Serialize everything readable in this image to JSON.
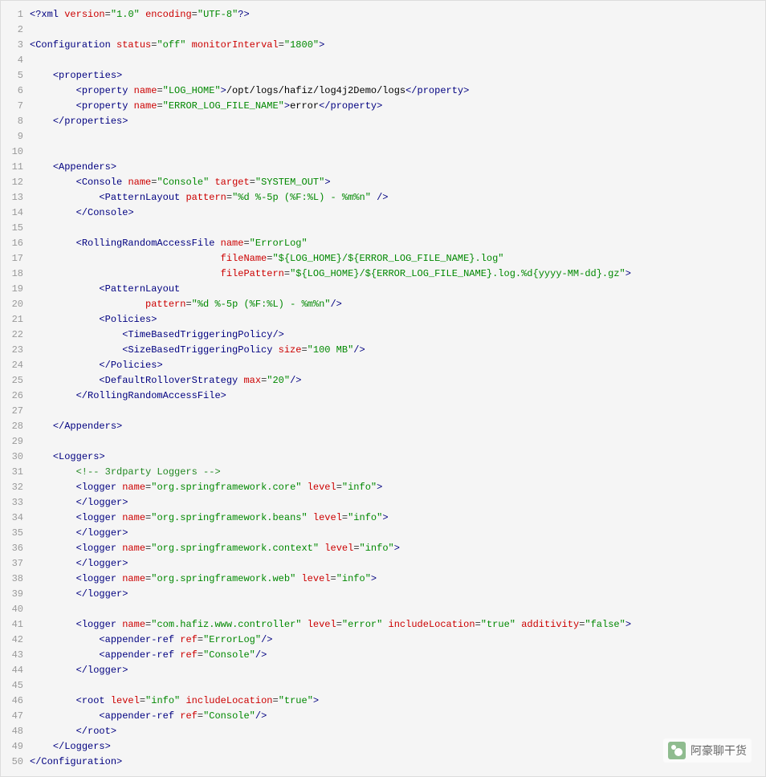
{
  "watermark": "阿豪聊干货",
  "lines": [
    {
      "n": 1,
      "h": "<span class='pi'>&lt;?</span><span class='tag'>xml</span> <span class='attr'>version</span>=<span class='val'>\"1.0\"</span> <span class='attr'>encoding</span>=<span class='val'>\"UTF-8\"</span><span class='pi'>?&gt;</span>"
    },
    {
      "n": 2,
      "h": ""
    },
    {
      "n": 3,
      "h": "<span class='punc'>&lt;</span><span class='tag'>Configuration</span> <span class='attr'>status</span>=<span class='val'>\"off\"</span> <span class='attr'>monitorInterval</span>=<span class='val'>\"1800\"</span><span class='punc'>&gt;</span>"
    },
    {
      "n": 4,
      "h": ""
    },
    {
      "n": 5,
      "h": "    <span class='punc'>&lt;</span><span class='tag'>properties</span><span class='punc'>&gt;</span>"
    },
    {
      "n": 6,
      "h": "        <span class='punc'>&lt;</span><span class='tag'>property</span> <span class='attr'>name</span>=<span class='val'>\"LOG_HOME\"</span><span class='punc'>&gt;</span><span class='txt'>/opt/logs/hafiz/log4j2Demo/logs</span><span class='punc'>&lt;/</span><span class='tag'>property</span><span class='punc'>&gt;</span>"
    },
    {
      "n": 7,
      "h": "        <span class='punc'>&lt;</span><span class='tag'>property</span> <span class='attr'>name</span>=<span class='val'>\"ERROR_LOG_FILE_NAME\"</span><span class='punc'>&gt;</span><span class='txt'>error</span><span class='punc'>&lt;/</span><span class='tag'>property</span><span class='punc'>&gt;</span>"
    },
    {
      "n": 8,
      "h": "    <span class='punc'>&lt;/</span><span class='tag'>properties</span><span class='punc'>&gt;</span>"
    },
    {
      "n": 9,
      "h": ""
    },
    {
      "n": 10,
      "h": ""
    },
    {
      "n": 11,
      "h": "    <span class='punc'>&lt;</span><span class='tag'>Appenders</span><span class='punc'>&gt;</span>"
    },
    {
      "n": 12,
      "h": "        <span class='punc'>&lt;</span><span class='tag'>Console</span> <span class='attr'>name</span>=<span class='val'>\"Console\"</span> <span class='attr'>target</span>=<span class='val'>\"SYSTEM_OUT\"</span><span class='punc'>&gt;</span>"
    },
    {
      "n": 13,
      "h": "            <span class='punc'>&lt;</span><span class='tag'>PatternLayout</span> <span class='attr'>pattern</span>=<span class='val'>\"%d %-5p (%F:%L) - %m%n\"</span> <span class='punc'>/&gt;</span>"
    },
    {
      "n": 14,
      "h": "        <span class='punc'>&lt;/</span><span class='tag'>Console</span><span class='punc'>&gt;</span>"
    },
    {
      "n": 15,
      "h": ""
    },
    {
      "n": 16,
      "h": "        <span class='punc'>&lt;</span><span class='tag'>RollingRandomAccessFile</span> <span class='attr'>name</span>=<span class='val'>\"ErrorLog\"</span>"
    },
    {
      "n": 17,
      "h": "                                 <span class='attr'>fileName</span>=<span class='val'>\"${LOG_HOME}/${ERROR_LOG_FILE_NAME}.log\"</span>"
    },
    {
      "n": 18,
      "h": "                                 <span class='attr'>filePattern</span>=<span class='val'>\"${LOG_HOME}/${ERROR_LOG_FILE_NAME}.log.%d{yyyy-MM-dd}.gz\"</span><span class='punc'>&gt;</span>"
    },
    {
      "n": 19,
      "h": "            <span class='punc'>&lt;</span><span class='tag'>PatternLayout</span>"
    },
    {
      "n": 20,
      "h": "                    <span class='attr'>pattern</span>=<span class='val'>\"%d %-5p (%F:%L) - %m%n\"</span><span class='punc'>/&gt;</span>"
    },
    {
      "n": 21,
      "h": "            <span class='punc'>&lt;</span><span class='tag'>Policies</span><span class='punc'>&gt;</span>"
    },
    {
      "n": 22,
      "h": "                <span class='punc'>&lt;</span><span class='tag'>TimeBasedTriggeringPolicy</span><span class='punc'>/&gt;</span>"
    },
    {
      "n": 23,
      "h": "                <span class='punc'>&lt;</span><span class='tag'>SizeBasedTriggeringPolicy</span> <span class='attr'>size</span>=<span class='val'>\"100 MB\"</span><span class='punc'>/&gt;</span>"
    },
    {
      "n": 24,
      "h": "            <span class='punc'>&lt;/</span><span class='tag'>Policies</span><span class='punc'>&gt;</span>"
    },
    {
      "n": 25,
      "h": "            <span class='punc'>&lt;</span><span class='tag'>DefaultRolloverStrategy</span> <span class='attr'>max</span>=<span class='val'>\"20\"</span><span class='punc'>/&gt;</span>"
    },
    {
      "n": 26,
      "h": "        <span class='punc'>&lt;/</span><span class='tag'>RollingRandomAccessFile</span><span class='punc'>&gt;</span>"
    },
    {
      "n": 27,
      "h": ""
    },
    {
      "n": 28,
      "h": "    <span class='punc'>&lt;/</span><span class='tag'>Appenders</span><span class='punc'>&gt;</span>"
    },
    {
      "n": 29,
      "h": ""
    },
    {
      "n": 30,
      "h": "    <span class='punc'>&lt;</span><span class='tag'>Loggers</span><span class='punc'>&gt;</span>"
    },
    {
      "n": 31,
      "h": "        <span class='comment'>&lt;!-- 3rdparty Loggers --&gt;</span>"
    },
    {
      "n": 32,
      "h": "        <span class='punc'>&lt;</span><span class='tag'>logger</span> <span class='attr'>name</span>=<span class='val'>\"org.springframework.core\"</span> <span class='attr'>level</span>=<span class='val'>\"info\"</span><span class='punc'>&gt;</span>"
    },
    {
      "n": 33,
      "h": "        <span class='punc'>&lt;/</span><span class='tag'>logger</span><span class='punc'>&gt;</span>"
    },
    {
      "n": 34,
      "h": "        <span class='punc'>&lt;</span><span class='tag'>logger</span> <span class='attr'>name</span>=<span class='val'>\"org.springframework.beans\"</span> <span class='attr'>level</span>=<span class='val'>\"info\"</span><span class='punc'>&gt;</span>"
    },
    {
      "n": 35,
      "h": "        <span class='punc'>&lt;/</span><span class='tag'>logger</span><span class='punc'>&gt;</span>"
    },
    {
      "n": 36,
      "h": "        <span class='punc'>&lt;</span><span class='tag'>logger</span> <span class='attr'>name</span>=<span class='val'>\"org.springframework.context\"</span> <span class='attr'>level</span>=<span class='val'>\"info\"</span><span class='punc'>&gt;</span>"
    },
    {
      "n": 37,
      "h": "        <span class='punc'>&lt;/</span><span class='tag'>logger</span><span class='punc'>&gt;</span>"
    },
    {
      "n": 38,
      "h": "        <span class='punc'>&lt;</span><span class='tag'>logger</span> <span class='attr'>name</span>=<span class='val'>\"org.springframework.web\"</span> <span class='attr'>level</span>=<span class='val'>\"info\"</span><span class='punc'>&gt;</span>"
    },
    {
      "n": 39,
      "h": "        <span class='punc'>&lt;/</span><span class='tag'>logger</span><span class='punc'>&gt;</span>"
    },
    {
      "n": 40,
      "h": ""
    },
    {
      "n": 41,
      "h": "        <span class='punc'>&lt;</span><span class='tag'>logger</span> <span class='attr'>name</span>=<span class='val'>\"com.hafiz.www.controller\"</span> <span class='attr'>level</span>=<span class='val'>\"error\"</span> <span class='attr'>includeLocation</span>=<span class='val'>\"true\"</span> <span class='attr'>additivity</span>=<span class='val'>\"false\"</span><span class='punc'>&gt;</span>"
    },
    {
      "n": 42,
      "h": "            <span class='punc'>&lt;</span><span class='tag'>appender-ref</span> <span class='attr'>ref</span>=<span class='val'>\"ErrorLog\"</span><span class='punc'>/&gt;</span>"
    },
    {
      "n": 43,
      "h": "            <span class='punc'>&lt;</span><span class='tag'>appender-ref</span> <span class='attr'>ref</span>=<span class='val'>\"Console\"</span><span class='punc'>/&gt;</span>"
    },
    {
      "n": 44,
      "h": "        <span class='punc'>&lt;/</span><span class='tag'>logger</span><span class='punc'>&gt;</span>"
    },
    {
      "n": 45,
      "h": ""
    },
    {
      "n": 46,
      "h": "        <span class='punc'>&lt;</span><span class='tag'>root</span> <span class='attr'>level</span>=<span class='val'>\"info\"</span> <span class='attr'>includeLocation</span>=<span class='val'>\"true\"</span><span class='punc'>&gt;</span>"
    },
    {
      "n": 47,
      "h": "            <span class='punc'>&lt;</span><span class='tag'>appender-ref</span> <span class='attr'>ref</span>=<span class='val'>\"Console\"</span><span class='punc'>/&gt;</span>"
    },
    {
      "n": 48,
      "h": "        <span class='punc'>&lt;/</span><span class='tag'>root</span><span class='punc'>&gt;</span>"
    },
    {
      "n": 49,
      "h": "    <span class='punc'>&lt;/</span><span class='tag'>Loggers</span><span class='punc'>&gt;</span>"
    },
    {
      "n": 50,
      "h": "<span class='punc'>&lt;/</span><span class='tag'>Configuration</span><span class='punc'>&gt;</span>"
    }
  ]
}
